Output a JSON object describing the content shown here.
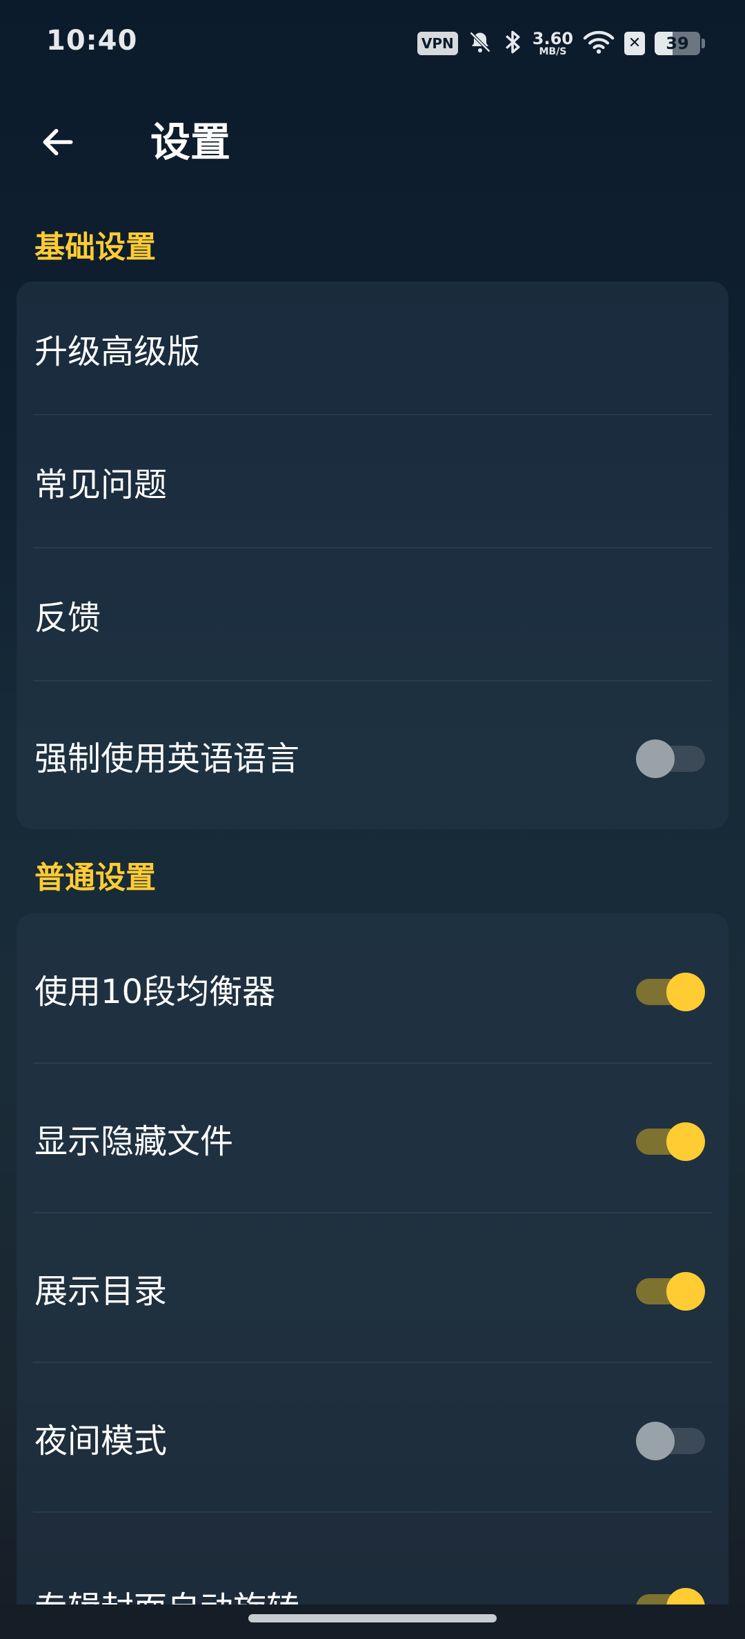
{
  "status_bar": {
    "time": "10:40",
    "vpn": "VPN",
    "speed_value": "3.60",
    "speed_unit": "MB/S",
    "battery_level": "39",
    "icons": [
      "vpn-icon",
      "bell-muted-icon",
      "bluetooth-icon",
      "wifi-icon",
      "sim-off-icon",
      "battery-icon"
    ]
  },
  "app_bar": {
    "title": "设置",
    "back_icon": "arrow-left-icon"
  },
  "sections": [
    {
      "header": "基础设置",
      "items": [
        {
          "label": "升级高级版"
        },
        {
          "label": "常见问题"
        },
        {
          "label": "反馈"
        },
        {
          "label": "强制使用英语语言",
          "toggle": false
        }
      ]
    },
    {
      "header": "普通设置",
      "items": [
        {
          "label": "使用10段均衡器",
          "toggle": true
        },
        {
          "label": "显示隐藏文件",
          "toggle": true
        },
        {
          "label": "展示目录",
          "toggle": true
        },
        {
          "label": "夜间模式",
          "toggle": false
        },
        {
          "label": "专辑封面自动旋转",
          "toggle": true
        }
      ]
    }
  ],
  "colors": {
    "accent": "#ffcc33",
    "toggle_on_track": "#7e7230",
    "toggle_off_track": "#3b4a56",
    "toggle_off_thumb": "#9aa2a9"
  }
}
